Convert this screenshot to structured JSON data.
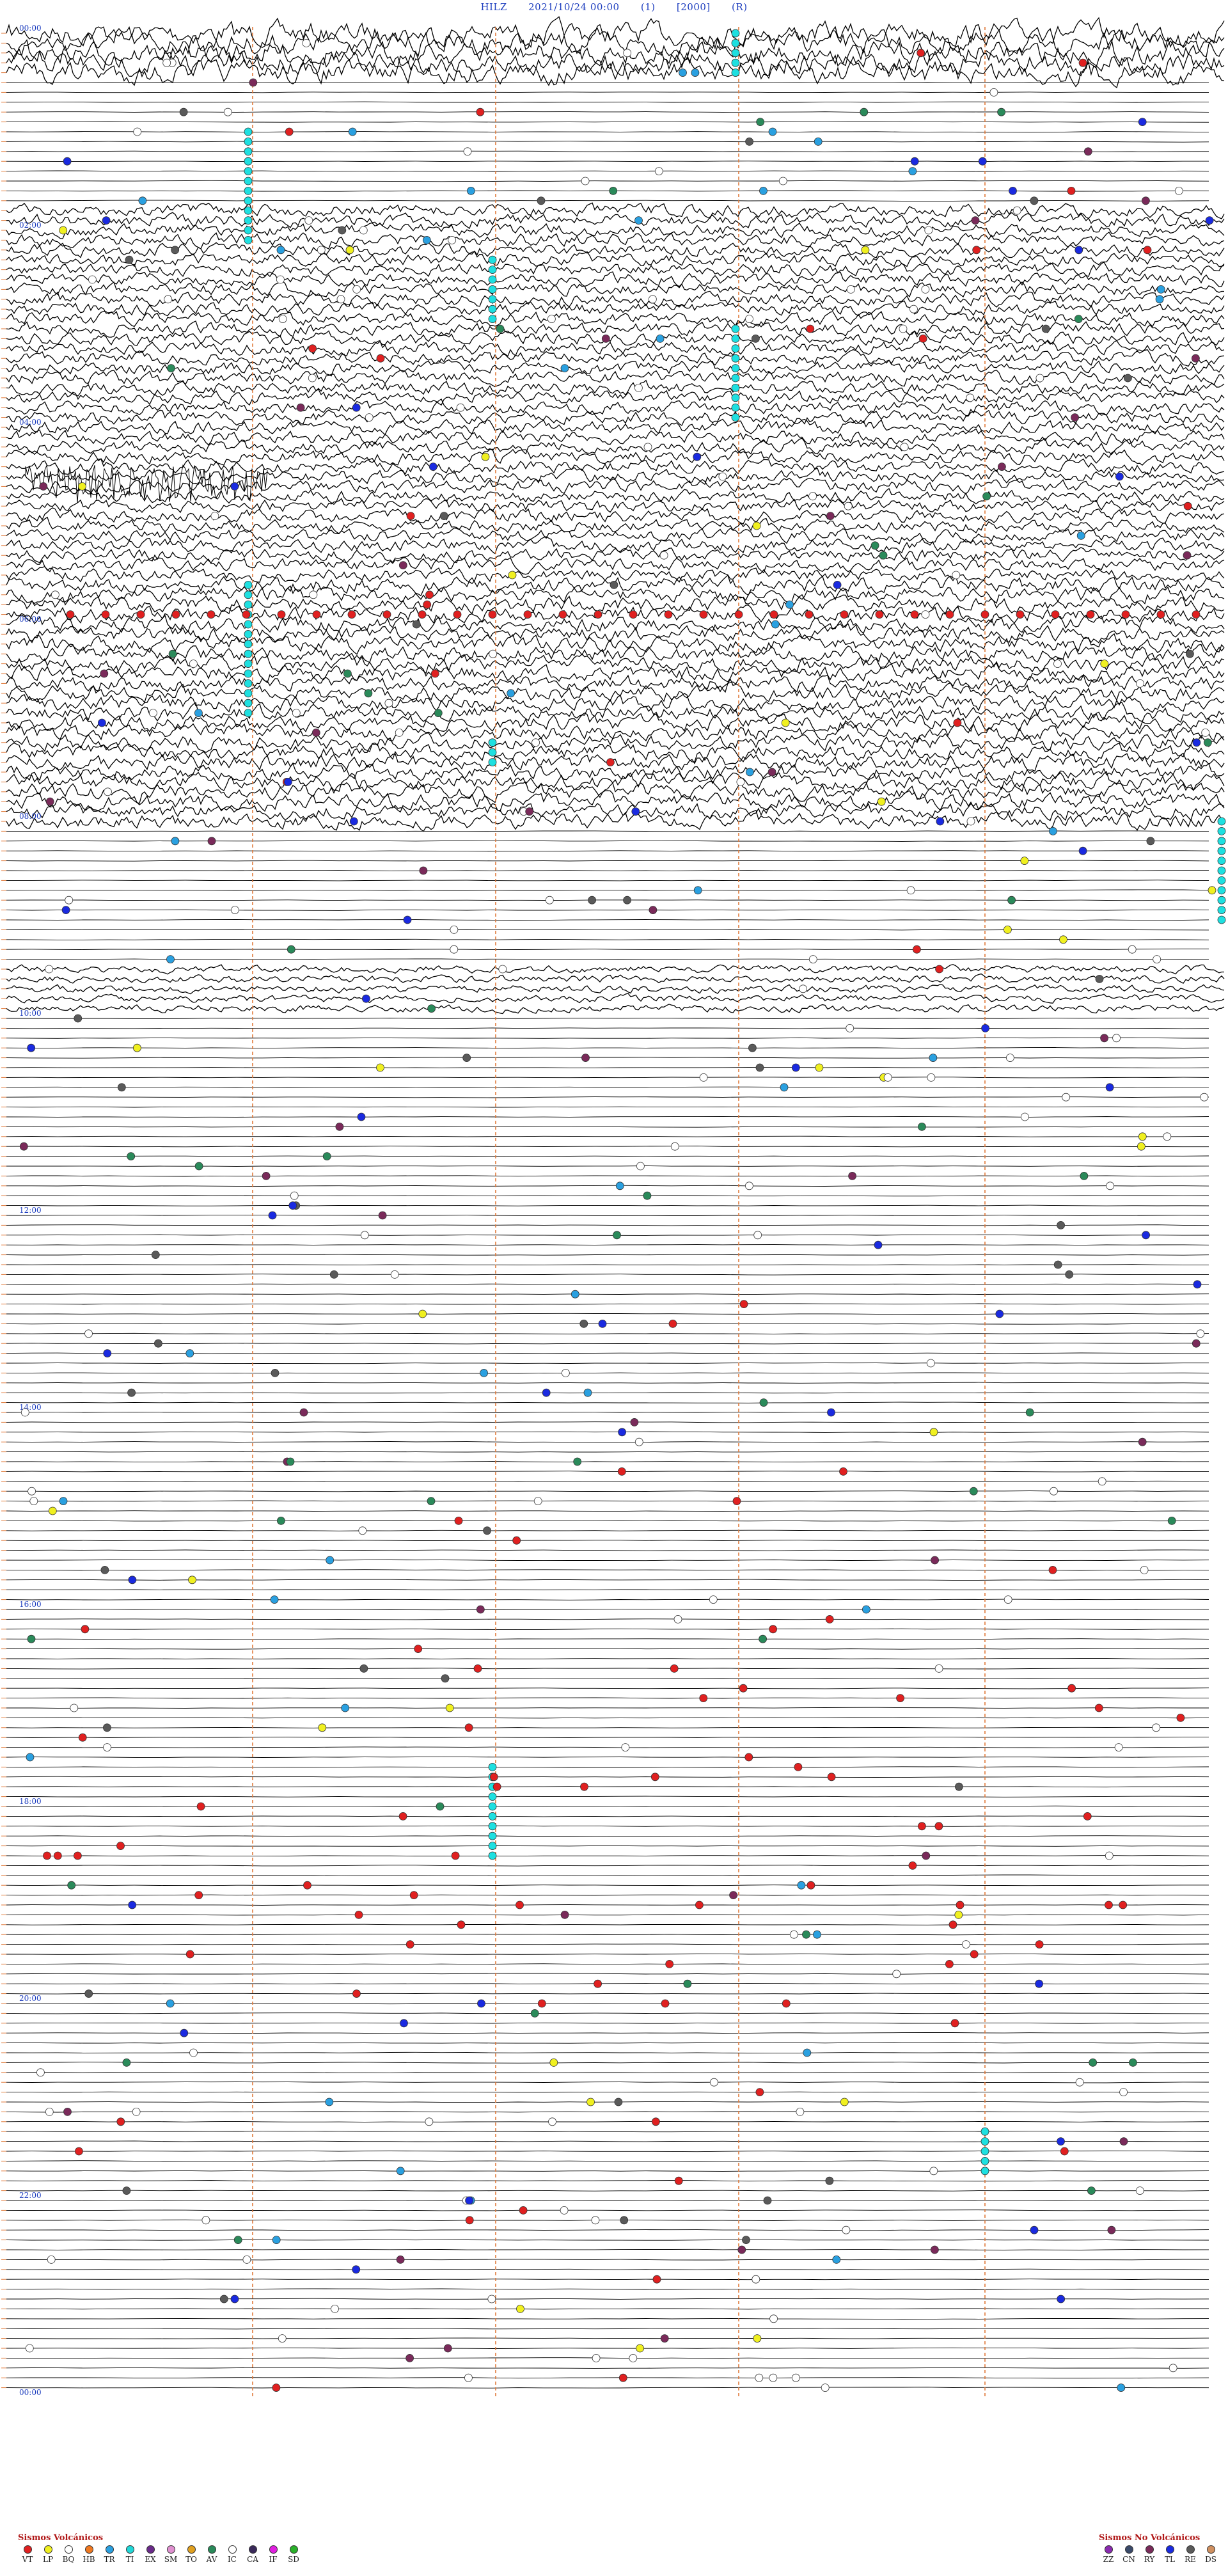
{
  "header": {
    "station": "HILZ",
    "datetime": "2021/10/24 00:00",
    "flag1": "(1)",
    "code": "[2000]",
    "flag2": "(R)"
  },
  "time_labels": [
    "00:00",
    "02:00",
    "04:00",
    "06:00",
    "08:00",
    "10:00",
    "12:00",
    "14:00",
    "16:00",
    "18:00",
    "20:00",
    "22:00",
    "00:00"
  ],
  "colors": {
    "trace": "#000000",
    "hour_label": "#1f3fbf",
    "marker_line": "#e07a3a",
    "cyan_marker": "#1ee0e0"
  },
  "legend_volcanic": {
    "title": "Sismos Volcánicos",
    "items": [
      {
        "code": "VT",
        "color": "#e02020"
      },
      {
        "code": "LP",
        "color": "#f0f020"
      },
      {
        "code": "BQ",
        "color": "#ffffff"
      },
      {
        "code": "HB",
        "color": "#f07820"
      },
      {
        "code": "TR",
        "color": "#2aa0e0"
      },
      {
        "code": "TI",
        "color": "#20d8d8"
      },
      {
        "code": "EX",
        "color": "#6a2a8a"
      },
      {
        "code": "SM",
        "color": "#e090d0"
      },
      {
        "code": "TO",
        "color": "#e0a020"
      },
      {
        "code": "AV",
        "color": "#2a8a5a"
      },
      {
        "code": "IC",
        "color": "#ffffff"
      },
      {
        "code": "CA",
        "color": "#3a2a5a"
      },
      {
        "code": "IF",
        "color": "#e020e0"
      },
      {
        "code": "SD",
        "color": "#2ab02a"
      }
    ]
  },
  "legend_nonvolcanic": {
    "title": "Sismos No Volcánicos",
    "items": [
      {
        "code": "ZZ",
        "color": "#8a2ab0"
      },
      {
        "code": "CN",
        "color": "#3a4a6a"
      },
      {
        "code": "RY",
        "color": "#7a2a5a"
      },
      {
        "code": "TL",
        "color": "#1a2ae0"
      },
      {
        "code": "RE",
        "color": "#5a5a5a"
      },
      {
        "code": "DS",
        "color": "#d09060"
      }
    ]
  }
}
